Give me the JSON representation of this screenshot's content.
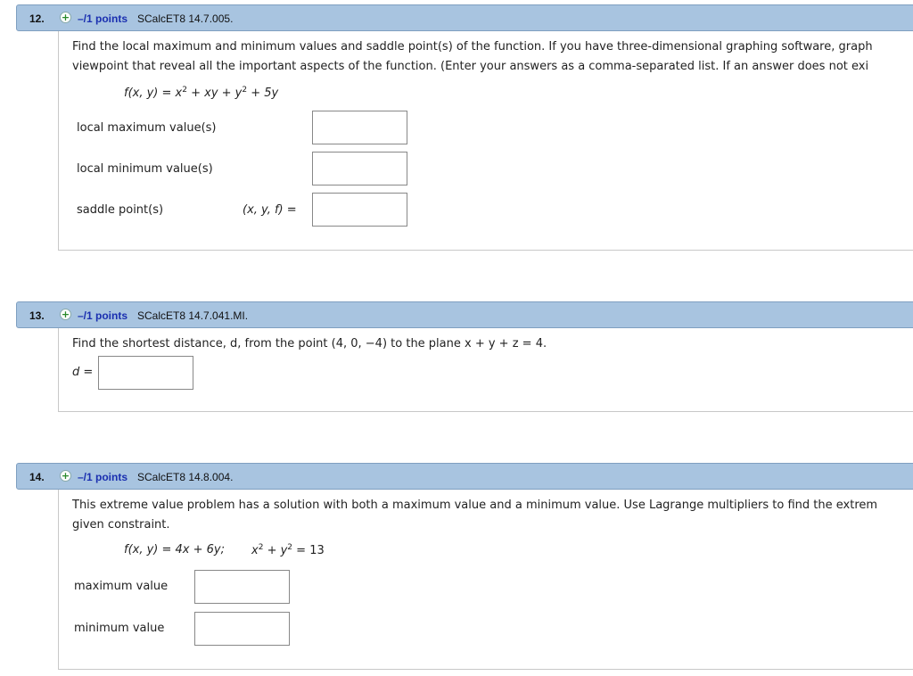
{
  "q12": {
    "number": "12.",
    "points": "–/1 points",
    "source": "SCalcET8 14.7.005.",
    "line1": "Find the local maximum and minimum values and saddle point(s) of the function. If you have three-dimensional graphing software, graph",
    "line2": "viewpoint that reveal all the important aspects of the function. (Enter your answers as a comma-separated list. If an answer does not exi",
    "function_lhs": "f(x, y) = x",
    "function_rest1": " + xy + y",
    "function_rest2": " + 5y",
    "exp": "2",
    "label_max": "local maximum value(s)",
    "label_min": "local minimum value(s)",
    "label_saddle": "saddle point(s)",
    "saddle_coords": "(x, y, f)  =",
    "answers": [
      "",
      "",
      ""
    ]
  },
  "q13": {
    "number": "13.",
    "points": "–/1 points",
    "source": "SCalcET8 14.7.041.MI.",
    "question": "Find the shortest distance, d, from the point  (4, 0, −4)  to the plane  x + y + z = 4.",
    "label_d": "d =",
    "answer": ""
  },
  "q14": {
    "number": "14.",
    "points": "–/1 points",
    "source": "SCalcET8 14.8.004.",
    "line1": "This extreme value problem has a solution with both a maximum value and a minimum value. Use Lagrange multipliers to find the extrem",
    "line2": "given constraint.",
    "function": "f(x, y) = 4x + 6y;",
    "constraint_a": "x",
    "constraint_b": " + y",
    "constraint_c": " = 13",
    "exp": "2",
    "label_max": "maximum value",
    "label_min": "minimum value",
    "answers": [
      "",
      ""
    ]
  }
}
